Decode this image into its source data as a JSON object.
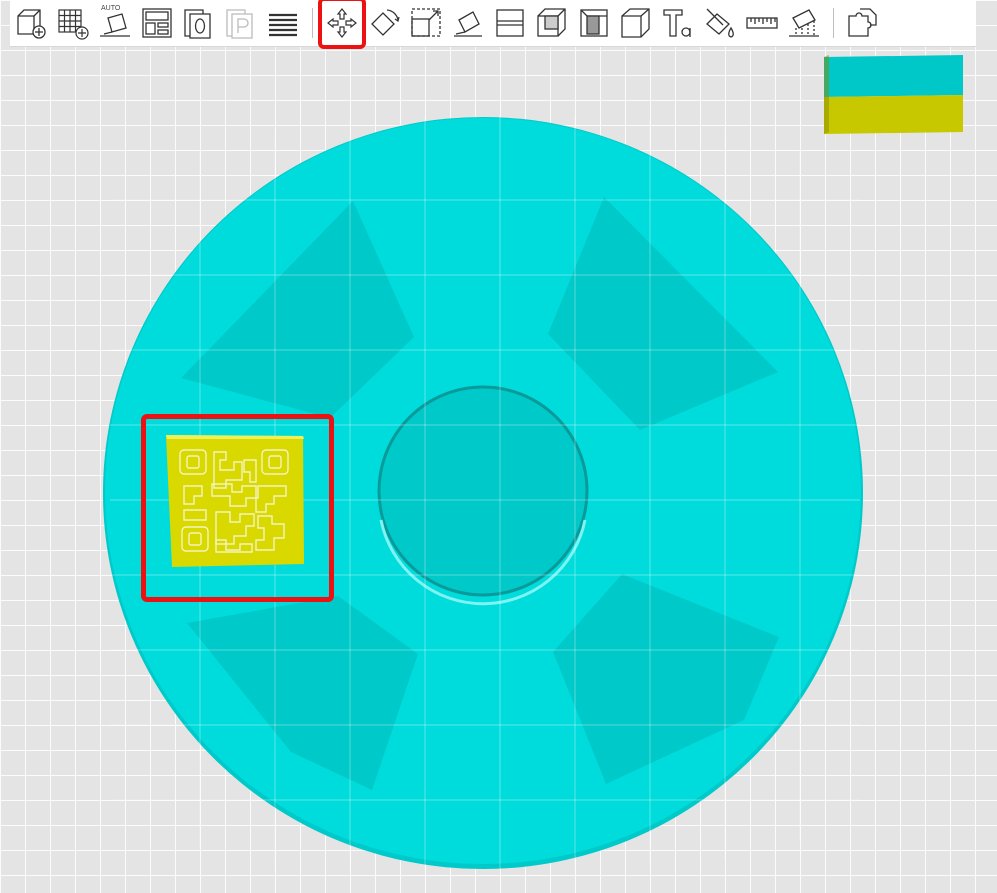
{
  "toolbar": {
    "auto_label": "AUTO",
    "tools": [
      {
        "icon": "add-box-icon",
        "active": false
      },
      {
        "icon": "add-grid-icon",
        "active": false
      },
      {
        "icon": "auto-layout-icon",
        "active": false
      },
      {
        "icon": "layout-panels-icon",
        "active": false
      },
      {
        "icon": "page-zero-icon",
        "active": false
      },
      {
        "icon": "page-p-icon",
        "active": false
      },
      {
        "icon": "layers-icon",
        "active": false
      },
      {
        "icon": "move-icon",
        "active": true
      },
      {
        "icon": "rotate-icon",
        "active": false
      },
      {
        "icon": "scale-icon",
        "active": false
      },
      {
        "icon": "lay-flat-icon",
        "active": false
      },
      {
        "icon": "cut-icon",
        "active": false
      },
      {
        "icon": "hollow-icon",
        "active": false
      },
      {
        "icon": "emboss-icon",
        "active": false
      },
      {
        "icon": "cube-icon",
        "active": false
      },
      {
        "icon": "text-icon",
        "active": false
      },
      {
        "icon": "paint-bucket-icon",
        "active": false
      },
      {
        "icon": "measure-icon",
        "active": false
      },
      {
        "icon": "support-icon",
        "active": false
      },
      {
        "icon": "puzzle-icon",
        "active": false
      }
    ]
  },
  "colors": {
    "model": "#00dede",
    "model_shadow": "#00c4c4",
    "qr_plate": "#dcdc00",
    "view_cube_top": "#00c8c8",
    "view_cube_bottom": "#c8c800",
    "selection": "#ee1111",
    "grid_bg": "#e4e4e4"
  }
}
